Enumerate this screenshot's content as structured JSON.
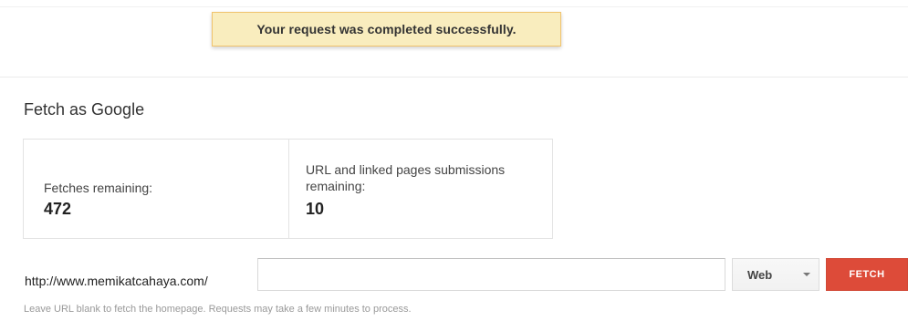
{
  "notification": {
    "message": "Your request was completed successfully."
  },
  "page": {
    "title": "Fetch as Google"
  },
  "stats": {
    "fetches_label": "Fetches remaining:",
    "fetches_value": "472",
    "submissions_label": "URL and linked pages submissions remaining:",
    "submissions_value": "10"
  },
  "fetch_form": {
    "url_prefix": "http://www.memikatcahaya.com/",
    "url_value": "",
    "url_placeholder": "",
    "fetch_type_selected": "Web",
    "fetch_button_label": "FETCH",
    "helper_text": "Leave URL blank to fetch the homepage. Requests may take a few minutes to process."
  },
  "colors": {
    "banner_background": "#f9edbe",
    "banner_border": "#f0c36d",
    "fetch_button": "#dd4b39"
  },
  "icons": {
    "select_caret": "chevron-down-icon"
  }
}
